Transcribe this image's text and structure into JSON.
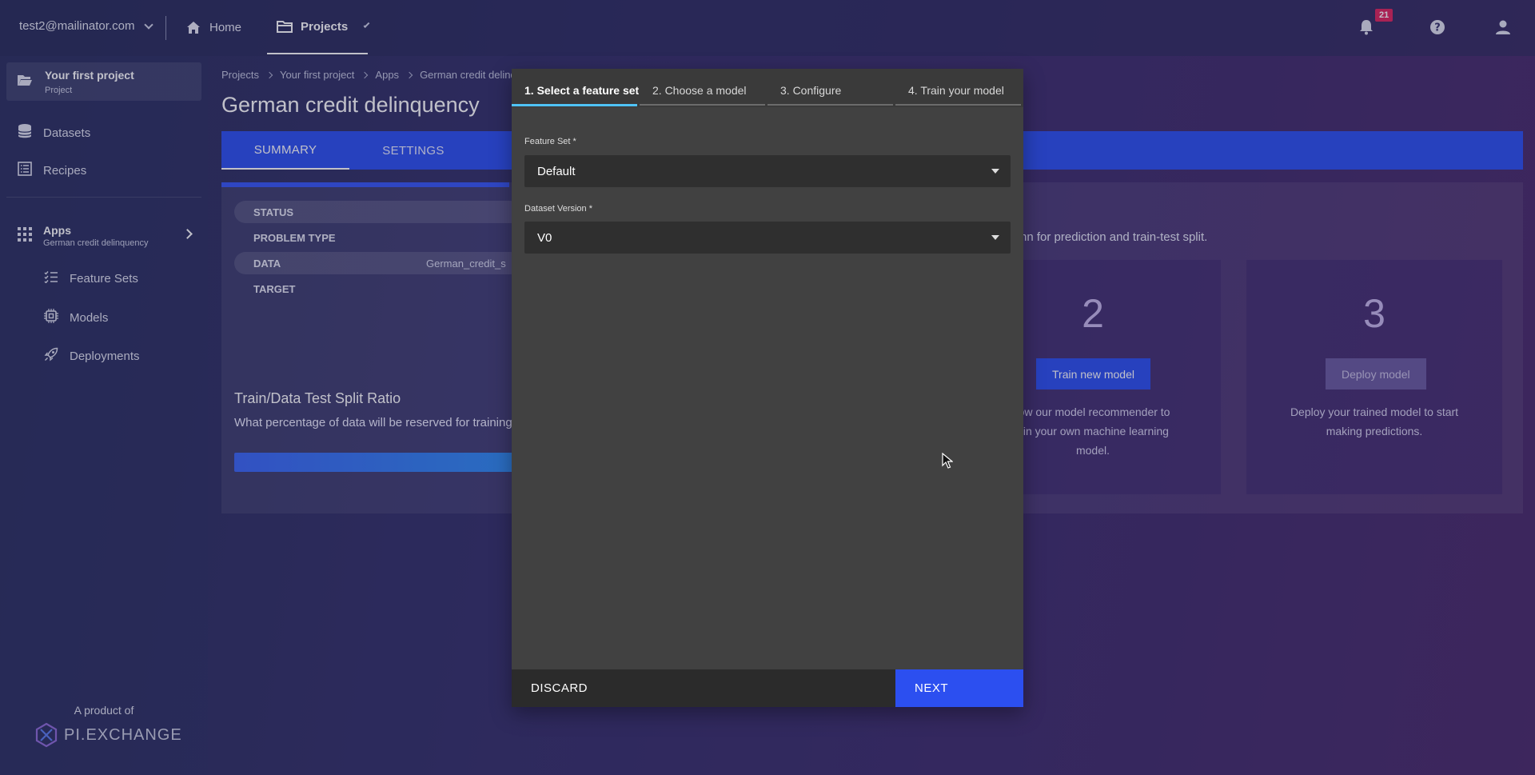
{
  "topbar": {
    "account": "test2@mailinator.com",
    "nav": {
      "home": "Home",
      "projects": "Projects"
    },
    "notifications_count": "21",
    "icons": [
      "chevron-down-icon",
      "home-icon",
      "folder-icon",
      "bell-icon",
      "help-icon",
      "user-icon"
    ]
  },
  "sidebar": {
    "project": {
      "title": "Your first project",
      "subtitle": "Project"
    },
    "items": {
      "datasets": "Datasets",
      "recipes": "Recipes"
    },
    "apps": {
      "title": "Apps",
      "subtitle": "German credit delinquency"
    },
    "subitems": {
      "feature_sets": "Feature Sets",
      "models": "Models",
      "deployments": "Deployments"
    },
    "product_of": "A product of",
    "logo_text": "PI.EXCHANGE"
  },
  "breadcrumb": [
    "Projects",
    "Your first project",
    "Apps",
    "German credit delinque"
  ],
  "page": {
    "title": "German credit delinquency",
    "tabs": [
      "SUMMARY",
      "SETTINGS"
    ],
    "info": [
      {
        "key": "STATUS",
        "value": ""
      },
      {
        "key": "PROBLEM TYPE",
        "value": ""
      },
      {
        "key": "DATA",
        "value": "German_credit_s"
      },
      {
        "key": "TARGET",
        "value": ""
      }
    ],
    "split_title": "Train/Data Test Split Ratio",
    "split_question": "What percentage of data will be reserved for training?",
    "hint": "nn for prediction and train-test split.",
    "steps": [
      {
        "number": "2",
        "button": "Train new model",
        "description_lines": [
          "low our model recommender to",
          "ain your own machine learning",
          "model."
        ]
      },
      {
        "number": "3",
        "button": "Deploy model",
        "description_lines": [
          "Deploy your trained model to start",
          "making predictions."
        ]
      }
    ]
  },
  "dialog": {
    "steps": [
      "1. Select a feature set",
      "2. Choose a model",
      "3. Configure",
      "4. Train your model"
    ],
    "active_step": 1,
    "feature_set": {
      "label": "Feature Set *",
      "value": "Default"
    },
    "dataset_version": {
      "label": "Dataset Version *",
      "value": "V0"
    },
    "discard": "DISCARD",
    "next": "NEXT"
  },
  "colors": {
    "accent": "#2c4ff0",
    "step_active": "#4fc3f7",
    "badge": "#e0245e",
    "dialog_bg": "#414141"
  }
}
